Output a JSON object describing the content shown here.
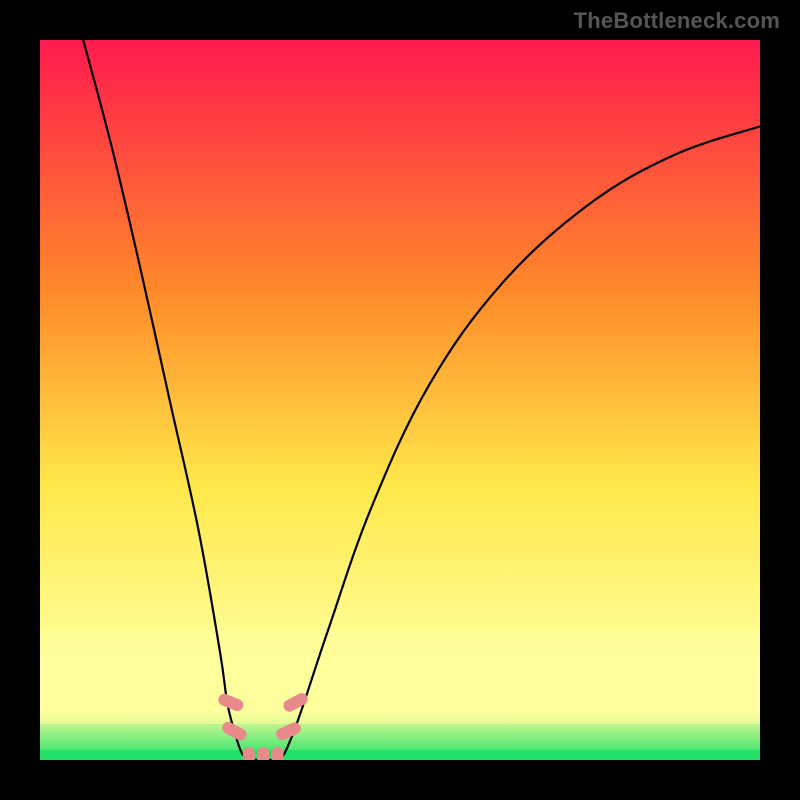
{
  "attribution": "TheBottleneck.com",
  "colors": {
    "bg": "#000000",
    "top": "#ff1a4e",
    "orange": "#ff8a2a",
    "yellow": "#ffe84a",
    "paleYellow": "#ffff9e",
    "green": "#22e06a",
    "curve": "#000000",
    "marker": "#e88a8a",
    "attribution": "#555555"
  },
  "chart_data": {
    "type": "line",
    "title": "",
    "xlabel": "",
    "ylabel": "",
    "xlim": [
      0,
      100
    ],
    "ylim": [
      0,
      100
    ],
    "grid": false,
    "series": [
      {
        "name": "left-curve",
        "x": [
          6,
          10,
          14,
          18,
          22,
          25,
          26,
          27,
          28,
          29
        ],
        "values": [
          100,
          85,
          68,
          50,
          32,
          15,
          8,
          4,
          1,
          0
        ]
      },
      {
        "name": "right-curve",
        "x": [
          33,
          34,
          36,
          40,
          46,
          54,
          64,
          76,
          88,
          100
        ],
        "values": [
          0,
          1,
          6,
          18,
          35,
          52,
          66,
          77,
          84,
          88
        ]
      },
      {
        "name": "floor",
        "x": [
          29,
          30,
          31,
          32,
          33
        ],
        "values": [
          0,
          0,
          0,
          0,
          0
        ]
      }
    ],
    "markers": [
      {
        "x": 26.5,
        "y": 8,
        "rot": -68
      },
      {
        "x": 27.0,
        "y": 4,
        "rot": -62
      },
      {
        "x": 29.0,
        "y": 0,
        "rot": 0
      },
      {
        "x": 31.0,
        "y": 0,
        "rot": 0
      },
      {
        "x": 33.0,
        "y": 0,
        "rot": 0
      },
      {
        "x": 34.5,
        "y": 4,
        "rot": 66
      },
      {
        "x": 35.5,
        "y": 8,
        "rot": 62
      }
    ]
  }
}
